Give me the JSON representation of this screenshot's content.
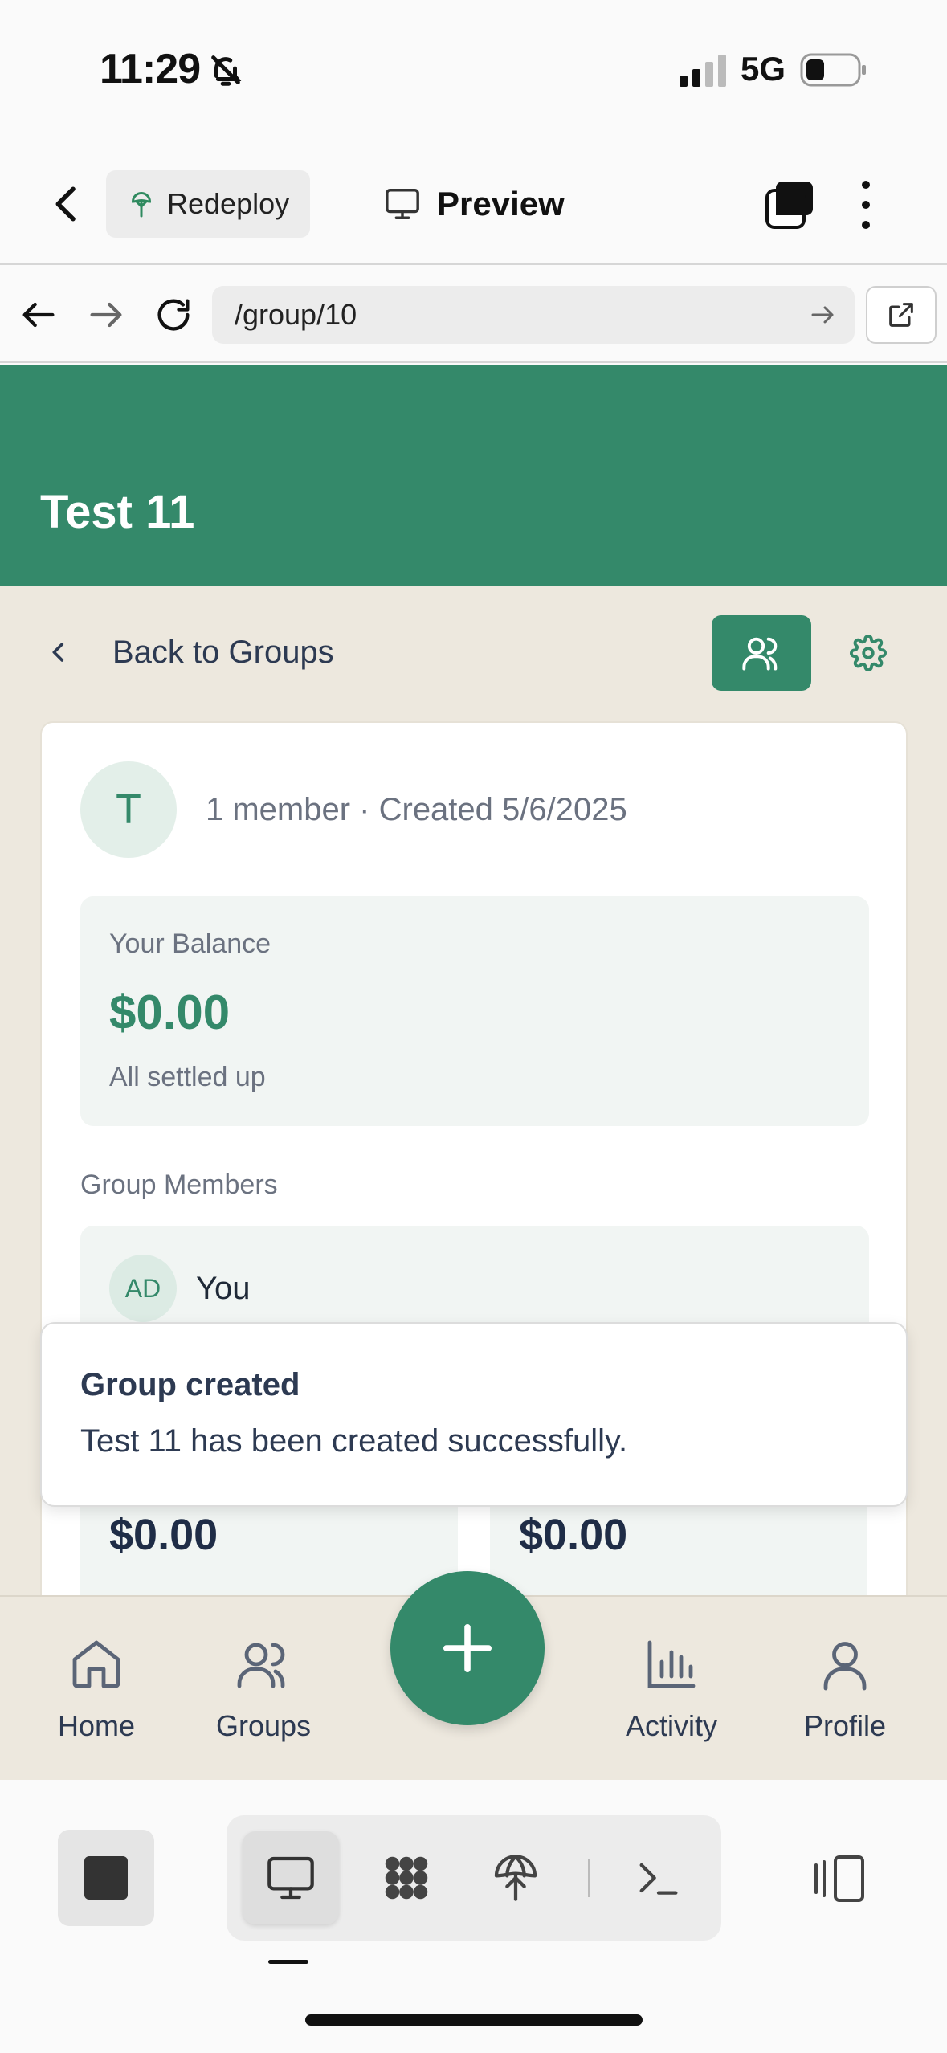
{
  "status_bar": {
    "time": "11:29",
    "network": "5G"
  },
  "app_header": {
    "redeploy_label": "Redeploy",
    "preview_label": "Preview"
  },
  "browser": {
    "url": "/group/10"
  },
  "page": {
    "title": "Test 11",
    "back_label": "Back to Groups",
    "group": {
      "avatar_letter": "T",
      "meta": "1 member · Created 5/6/2025",
      "balance_label": "Your Balance",
      "balance_amount": "$0.00",
      "balance_status": "All settled up",
      "members_heading": "Group Members",
      "members": [
        {
          "initials": "AD",
          "name": "You"
        }
      ],
      "stats": [
        {
          "amount": "$0.00"
        },
        {
          "amount": "$0.00"
        }
      ]
    }
  },
  "toast": {
    "title": "Group created",
    "message": "Test 11 has been created successfully."
  },
  "bottom_nav": {
    "items": [
      {
        "label": "Home"
      },
      {
        "label": "Groups"
      },
      {
        "label": "Activity"
      },
      {
        "label": "Profile"
      }
    ]
  },
  "colors": {
    "brand_green": "#34896a",
    "page_bg": "#ede8de",
    "text_dark": "#2d3a52"
  }
}
